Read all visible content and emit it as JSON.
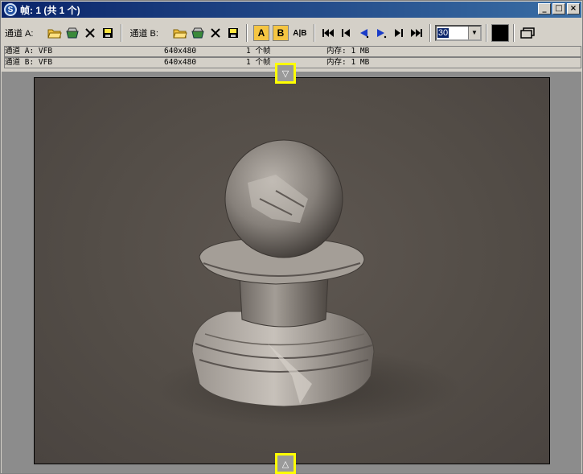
{
  "window": {
    "title": "帧: 1 (共 1 个)",
    "icon": "3dsmax-icon",
    "buttons": [
      "_",
      "□",
      "×"
    ]
  },
  "toolbar": {
    "channel_a_label": "通道 A:",
    "channel_b_label": "通道 B:",
    "ab_a": "A",
    "ab_b": "B",
    "ab_split": "A|B",
    "frame_value": "30",
    "color_swatch": "#000000"
  },
  "info": {
    "rows": [
      {
        "channel": "通道 A: VFB",
        "res": "640x480",
        "frames": "1 个帧",
        "memory": "内存: 1 MB"
      },
      {
        "channel": "通道 B: VFB",
        "res": "640x480",
        "frames": "1 个帧",
        "memory": "内存: 1 MB"
      }
    ]
  },
  "markers": {
    "top": "▽",
    "bottom": "△"
  }
}
